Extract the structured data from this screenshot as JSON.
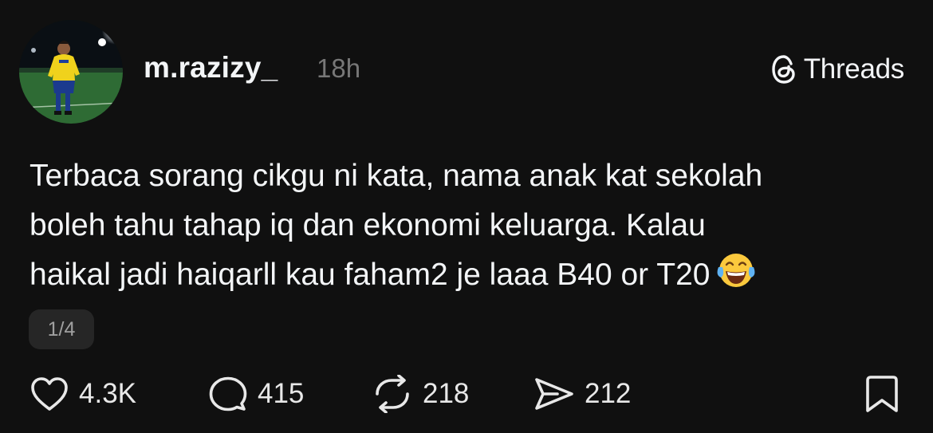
{
  "post": {
    "username": "m.razizy_",
    "timestamp": "18h",
    "brand": "Threads",
    "text_lines": [
      "Terbaca sorang cikgu ni kata, nama anak kat sekolah",
      "boleh tahu tahap iq dan ekonomi keluarga. Kalau",
      "haikal jadi haiqarll kau faham2 je laaa B40 or T20"
    ],
    "emoji": "tears-of-joy-emoji",
    "pager": "1/4"
  },
  "actions": {
    "likes": "4.3K",
    "replies": "415",
    "reposts": "218",
    "shares": "212"
  },
  "icons": {
    "like": "heart-icon",
    "reply": "comment-icon",
    "repost": "repost-icon",
    "share": "send-icon",
    "save": "bookmark-icon",
    "brand": "threads-logo-icon"
  },
  "colors": {
    "background": "#101010",
    "text": "#f3f5f7",
    "muted": "#777777",
    "pager_bg": "#262626"
  }
}
